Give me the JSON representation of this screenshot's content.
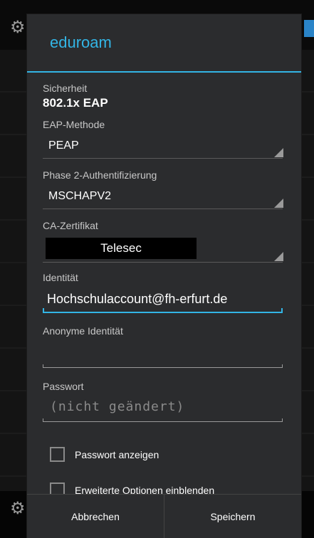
{
  "dialog": {
    "title": "eduroam",
    "security": {
      "label": "Sicherheit",
      "value": "802.1x EAP"
    },
    "eap_method": {
      "label": "EAP-Methode",
      "value": "PEAP"
    },
    "phase2": {
      "label": "Phase 2-Authentifizierung",
      "value": "MSCHAPV2"
    },
    "ca_cert": {
      "label": "CA-Zertifikat",
      "value": "Telesec"
    },
    "identity": {
      "label": "Identität",
      "value": "Hochschulaccount@fh-erfurt.de"
    },
    "anon_identity": {
      "label": "Anonyme Identität",
      "value": ""
    },
    "password": {
      "label": "Passwort",
      "placeholder": "(nicht geändert)"
    },
    "show_password": {
      "label": "Passwort anzeigen",
      "checked": false
    },
    "advanced": {
      "label": "Erweiterte Optionen einblenden",
      "checked": false
    },
    "buttons": {
      "cancel": "Abbrechen",
      "save": "Speichern"
    }
  },
  "colors": {
    "accent": "#33b5e5",
    "dialog_bg": "#2b2c2e"
  }
}
